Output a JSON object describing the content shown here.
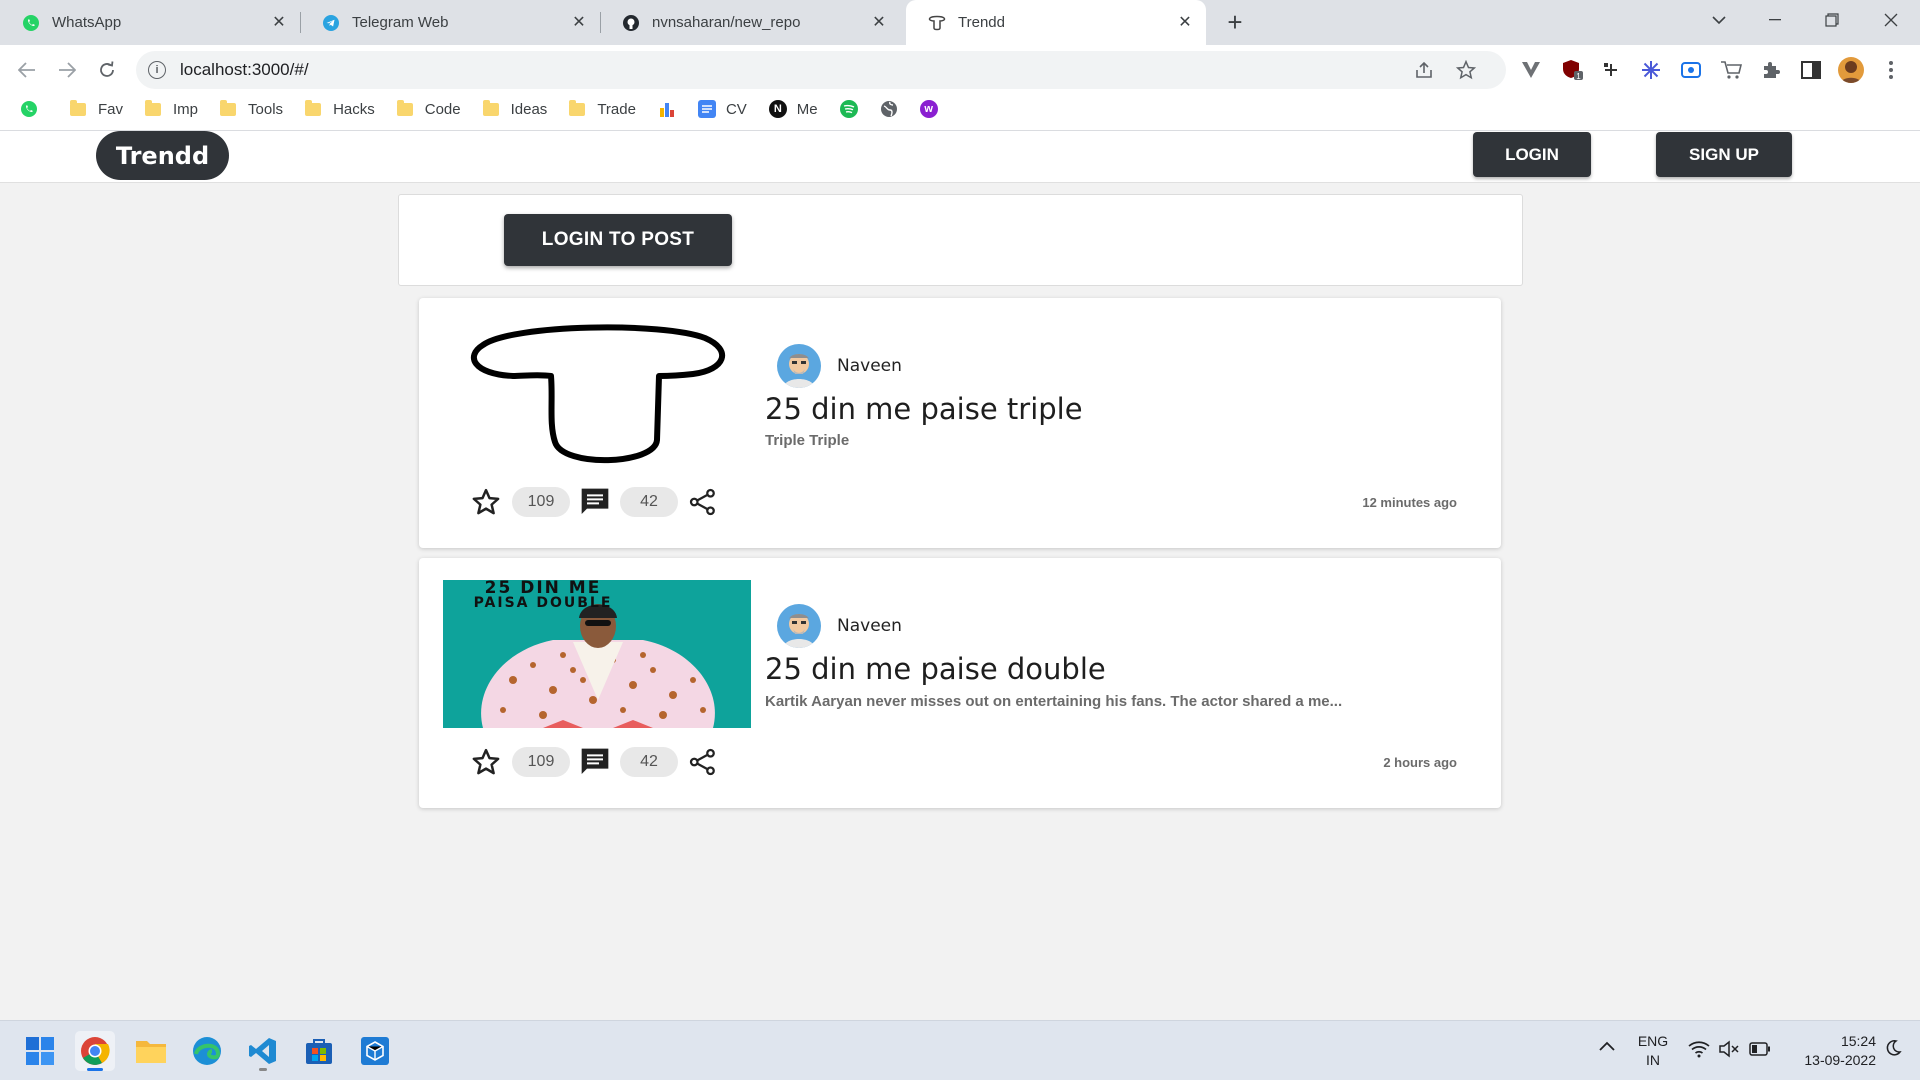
{
  "browser": {
    "tabs": [
      {
        "label": "WhatsApp",
        "icon": "whatsapp-icon",
        "active": false
      },
      {
        "label": "Telegram Web",
        "icon": "telegram-icon",
        "active": false
      },
      {
        "label": "nvnsaharan/new_repo",
        "icon": "github-icon",
        "active": false
      },
      {
        "label": "Trendd",
        "icon": "trendd-favicon-icon",
        "active": true
      }
    ],
    "new_tab_label": "+",
    "url": "localhost:3000/#/",
    "bookmarks": [
      {
        "label": "",
        "icon": "whatsapp-icon"
      },
      {
        "label": "Fav",
        "icon": "folder-icon"
      },
      {
        "label": "Imp",
        "icon": "folder-icon"
      },
      {
        "label": "Tools",
        "icon": "folder-icon"
      },
      {
        "label": "Hacks",
        "icon": "folder-icon"
      },
      {
        "label": "Code",
        "icon": "folder-icon"
      },
      {
        "label": "Ideas",
        "icon": "folder-icon"
      },
      {
        "label": "Trade",
        "icon": "folder-icon"
      },
      {
        "label": "",
        "icon": "bar-chart-icon"
      },
      {
        "label": "CV",
        "icon": "docs-icon"
      },
      {
        "label": "Me",
        "icon": "notion-icon"
      },
      {
        "label": "",
        "icon": "spotify-icon"
      },
      {
        "label": "",
        "icon": "globe-icon"
      },
      {
        "label": "",
        "icon": "purple-w-icon"
      }
    ],
    "accent": "#1a73e8"
  },
  "app": {
    "brand": "Trendd",
    "login_label": "LOGIN",
    "signup_label": "SIGN UP",
    "login_to_post_label": "LOGIN TO POST",
    "dark_color": "#303439"
  },
  "posts": [
    {
      "author": "Naveen",
      "title": "25 din me paise triple",
      "description": "Triple Triple",
      "time": "12 minutes ago",
      "stars": "109",
      "comments": "42",
      "thumbnail": "trendd-logo-drawing"
    },
    {
      "author": "Naveen",
      "title": "25 din me paise double",
      "description": "Kartik Aaryan never misses out on entertaining his fans. The actor shared a me...",
      "time": "2 hours ago",
      "stars": "109",
      "comments": "42",
      "thumbnail": "poster-image",
      "thumbnail_text_line1": "25 DIN ME",
      "thumbnail_text_line2": "PAISA DOUBLE"
    }
  ],
  "taskbar": {
    "apps": [
      "windows-start-icon",
      "chrome-icon",
      "file-explorer-icon",
      "edge-icon",
      "vscode-icon",
      "store-icon",
      "app-cube-icon"
    ],
    "language_line1": "ENG",
    "language_line2": "IN",
    "time": "15:24",
    "date": "13-09-2022"
  }
}
